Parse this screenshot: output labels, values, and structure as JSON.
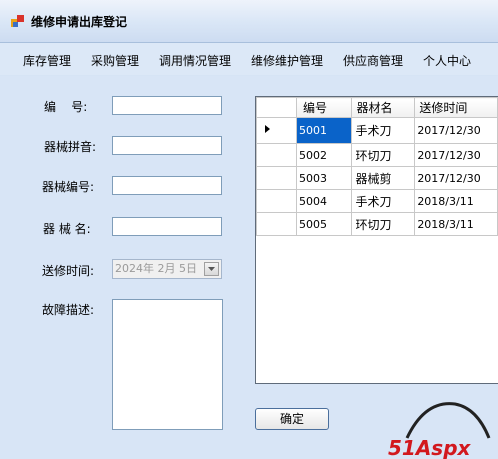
{
  "window": {
    "title": "维修申请出库登记"
  },
  "menu": [
    "库存管理",
    "采购管理",
    "调用情况管理",
    "维修维护管理",
    "供应商管理",
    "个人中心"
  ],
  "form": {
    "label_code": "编    号:",
    "label_pinyin": "器械拼音:",
    "label_equip_code": "器械编号:",
    "label_equip_name": "器 械 名:",
    "label_send_time": "送修时间:",
    "label_fault": "故障描述:",
    "date_value": "2024年 2月 5日",
    "confirm_label": "确定"
  },
  "grid": {
    "columns": [
      "编号",
      "器材名",
      "送修时间"
    ],
    "rows": [
      [
        "5001",
        "手术刀",
        "2017/12/30"
      ],
      [
        "5002",
        "环切刀",
        "2017/12/30"
      ],
      [
        "5003",
        "器械剪",
        "2017/12/30"
      ],
      [
        "5004",
        "手术刀",
        "2018/3/11"
      ],
      [
        "5005",
        "环切刀",
        "2018/3/11"
      ]
    ]
  },
  "watermark": {
    "text": "51Aspx",
    "color": "#d2181e"
  }
}
